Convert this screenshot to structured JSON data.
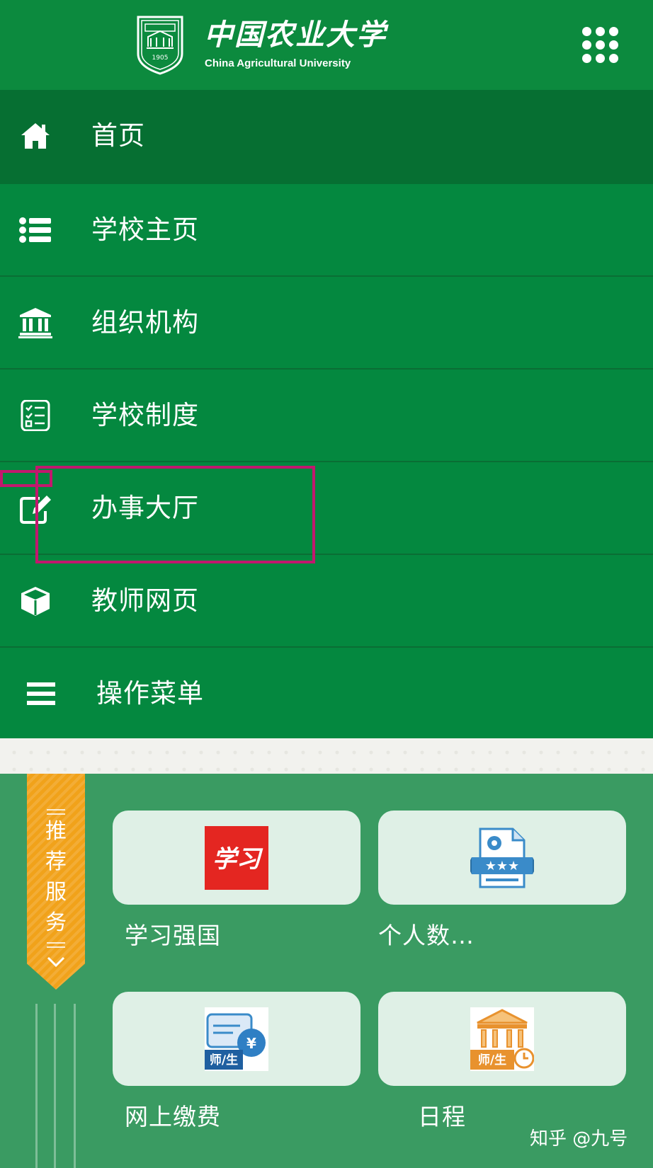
{
  "header": {
    "logo_cn": "中国农业大学",
    "logo_en": "China Agricultural University",
    "seal_year": "1905",
    "menu_button": "app-grid"
  },
  "menu": {
    "items": [
      {
        "label": "首页",
        "icon": "home-icon"
      },
      {
        "label": "学校主页",
        "icon": "list-icon"
      },
      {
        "label": "组织机构",
        "icon": "institution-icon"
      },
      {
        "label": "学校制度",
        "icon": "checklist-icon"
      },
      {
        "label": "办事大厅",
        "icon": "edit-icon"
      },
      {
        "label": "教师网页",
        "icon": "cube-icon"
      },
      {
        "label": "操作菜单",
        "icon": "hamburger-icon"
      }
    ]
  },
  "services": {
    "ribbon": [
      "推",
      "荐",
      "服",
      "务"
    ],
    "tiles": [
      {
        "label": "学习强国",
        "icon": "xuexi-qiangguo-icon",
        "icon_text": "学习"
      },
      {
        "label": "个人数…",
        "icon": "certificate-icon"
      },
      {
        "label": "网上缴费",
        "icon": "payment-card-icon",
        "icon_text": "师/生"
      },
      {
        "label": "日程",
        "icon": "calendar-building-icon",
        "icon_text": "师/生"
      }
    ]
  },
  "watermark": "知乎 @九号",
  "colors": {
    "brand_green": "#0c8a3e",
    "menu_active": "#066f32",
    "services_bg": "#3a9b62",
    "ribbon_orange": "#f1a21a",
    "highlight": "#c2186e"
  }
}
